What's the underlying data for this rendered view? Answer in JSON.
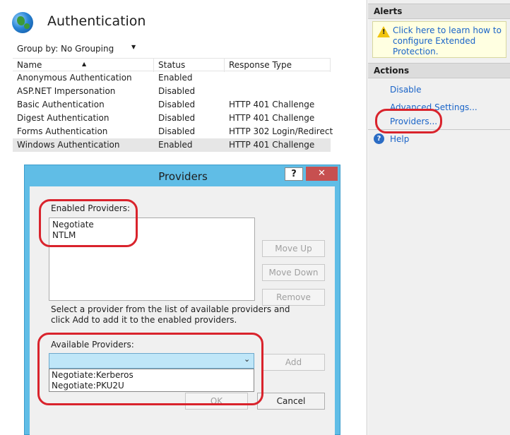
{
  "main": {
    "title": "Authentication",
    "group_by_label": "Group by:",
    "group_by_value": "No Grouping",
    "columns": [
      "Name",
      "Status",
      "Response Type"
    ],
    "rows": [
      {
        "name": "Anonymous Authentication",
        "status": "Enabled",
        "response": ""
      },
      {
        "name": "ASP.NET Impersonation",
        "status": "Disabled",
        "response": ""
      },
      {
        "name": "Basic Authentication",
        "status": "Disabled",
        "response": "HTTP 401 Challenge"
      },
      {
        "name": "Digest Authentication",
        "status": "Disabled",
        "response": "HTTP 401 Challenge"
      },
      {
        "name": "Forms Authentication",
        "status": "Disabled",
        "response": "HTTP 302 Login/Redirect"
      },
      {
        "name": "Windows Authentication",
        "status": "Enabled",
        "response": "HTTP 401 Challenge"
      }
    ]
  },
  "side": {
    "alerts_header": "Alerts",
    "alert_text": "Click here to learn how to configure Extended Protection.",
    "actions_header": "Actions",
    "actions": [
      "Disable",
      "Advanced Settings...",
      "Providers..."
    ],
    "help": "Help"
  },
  "dialog": {
    "title": "Providers",
    "help_glyph": "?",
    "close_glyph": "✕",
    "enabled_label": "Enabled Providers:",
    "enabled_items": [
      "Negotiate",
      "NTLM"
    ],
    "buttons": {
      "move_up": "Move Up",
      "move_down": "Move Down",
      "remove": "Remove",
      "add": "Add",
      "ok": "OK",
      "cancel": "Cancel"
    },
    "hint": "Select a provider from the list of available providers and click Add to add it to the enabled providers.",
    "available_label": "Available Providers:",
    "available_items": [
      "Negotiate:Kerberos",
      "Negotiate:PKU2U"
    ]
  },
  "colors": {
    "accent": "#60bde6",
    "highlight": "#d9232c",
    "link": "#1a64c8"
  }
}
